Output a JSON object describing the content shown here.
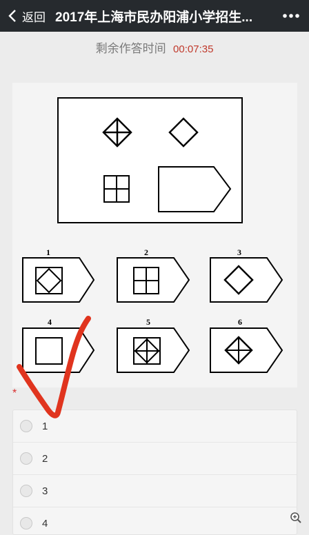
{
  "header": {
    "back_label": "返回",
    "title": "2017年上海市民办阳浦小学招生...",
    "back_icon": "chevron-left-icon",
    "more_icon": "more-dots-icon"
  },
  "timer": {
    "label": "剩余作答时间",
    "value": "00:07:35",
    "value_color": "#c0392b"
  },
  "question": {
    "required_mark": "*",
    "choice_numbers": [
      "1",
      "2",
      "3",
      "4",
      "5",
      "6"
    ]
  },
  "options": [
    {
      "label": "1"
    },
    {
      "label": "2"
    },
    {
      "label": "3"
    },
    {
      "label": "4"
    }
  ],
  "annotation_color": "#e0341e",
  "zoom_icon": "zoom-in-icon"
}
